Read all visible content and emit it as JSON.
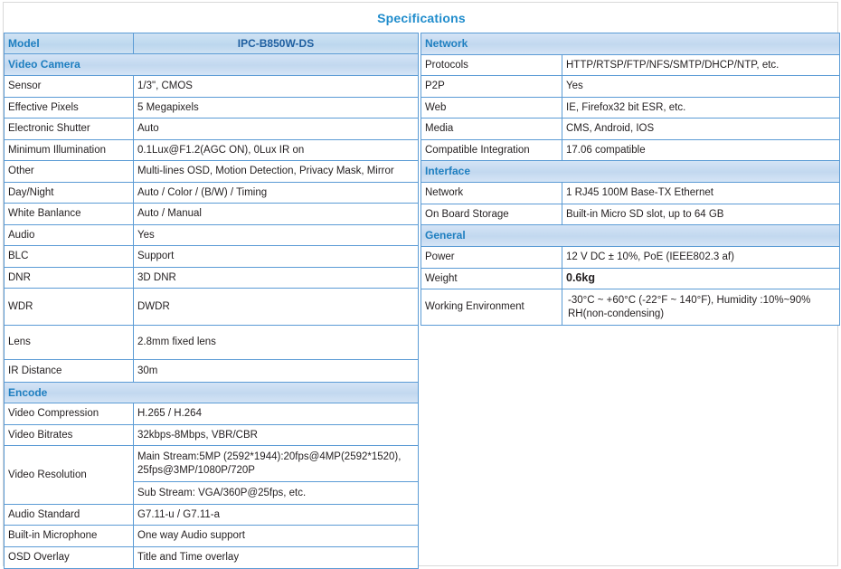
{
  "title": "Specifications",
  "accent_color": "#1f8ccc",
  "border_color": "#5b9bd5",
  "header_bg": "#c6dbf0",
  "left_table": {
    "model": {
      "key": "Model",
      "value": "IPC-B850W-DS"
    },
    "sections": [
      {
        "name": "Video Camera",
        "rows": [
          {
            "key": "Sensor",
            "value": "1/3\", CMOS"
          },
          {
            "key": "Effective Pixels",
            "value": "5 Megapixels"
          },
          {
            "key": "Electronic Shutter",
            "value": "Auto"
          },
          {
            "key": "Minimum Illumination",
            "value": "0.1Lux@F1.2(AGC ON), 0Lux IR on"
          },
          {
            "key": "Other",
            "value": "Multi-lines OSD, Motion Detection, Privacy Mask, Mirror"
          },
          {
            "key": "Day/Night",
            "value": "Auto / Color / (B/W) / Timing"
          },
          {
            "key": "White Banlance",
            "value": "Auto / Manual"
          },
          {
            "key": "Audio",
            "value": "Yes"
          },
          {
            "key": "BLC",
            "value": "Support"
          },
          {
            "key": "DNR",
            "value": "3D DNR"
          },
          {
            "key": "WDR",
            "value": "DWDR"
          },
          {
            "key": "Lens",
            "value": "2.8mm fixed lens"
          },
          {
            "key": "IR Distance",
            "value": "30m"
          }
        ]
      },
      {
        "name": "Encode",
        "rows": [
          {
            "key": "Video Compression",
            "value": "H.265 / H.264"
          },
          {
            "key": "Video Bitrates",
            "value": "32kbps-8Mbps, VBR/CBR"
          },
          {
            "key": "Video Resolution",
            "value": "Main Stream:5MP (2592*1944):20fps@4MP(2592*1520), 25fps@3MP/1080P/720P"
          },
          {
            "key": "",
            "value": "Sub Stream: VGA/360P@25fps, etc."
          },
          {
            "key": "Audio Standard",
            "value": "G7.11-u / G7.11-a"
          },
          {
            "key": "Built-in Microphone",
            "value": "One way Audio support"
          },
          {
            "key": "OSD Overlay",
            "value": "Title and Time overlay"
          }
        ]
      }
    ]
  },
  "right_table": {
    "sections": [
      {
        "name": "Network",
        "rows": [
          {
            "key": "Protocols",
            "value": "HTTP/RTSP/FTP/NFS/SMTP/DHCP/NTP, etc."
          },
          {
            "key": "P2P",
            "value": "Yes"
          },
          {
            "key": "Web",
            "value": "IE, Firefox32 bit ESR, etc."
          },
          {
            "key": "Media",
            "value": "CMS, Android, IOS"
          },
          {
            "key": "Compatible Integration",
            "value": "17.06 compatible"
          }
        ]
      },
      {
        "name": "Interface",
        "rows": [
          {
            "key": "Network",
            "value": "1 RJ45 100M Base-TX Ethernet"
          },
          {
            "key": "On Board Storage",
            "value": "Built-in Micro SD slot, up to 64 GB"
          }
        ]
      },
      {
        "name": "General",
        "rows": [
          {
            "key": "Power",
            "value": "12 V DC ± 10%, PoE (IEEE802.3 af)"
          },
          {
            "key": "Weight",
            "value": "0.6kg"
          },
          {
            "key": "Working Environment",
            "value": "-30°C ~ +60°C (-22°F ~ 140°F), Humidity :10%~90% RH(non-condensing)"
          }
        ]
      }
    ]
  }
}
